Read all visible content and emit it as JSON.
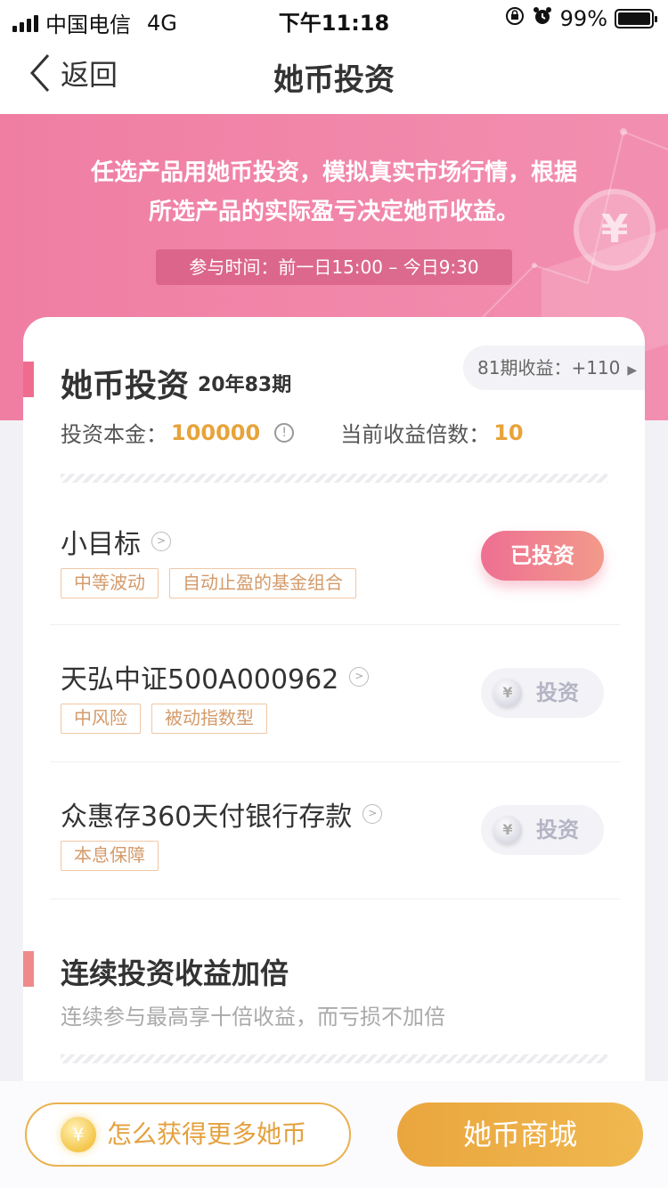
{
  "status_bar": {
    "carrier": "中国电信",
    "network": "4G",
    "time": "下午11:18",
    "battery": "99%",
    "battery_level": 0.99
  },
  "nav": {
    "back_label": "返回",
    "title": "她币投资"
  },
  "banner": {
    "line1": "任选产品用她币投资，模拟真实市场行情，根据",
    "line2": "所选产品的实际盈亏决定她币收益。",
    "time": "参与时间：前一日15:00 – 今日9:30",
    "coin_symbol": "¥"
  },
  "invest_card": {
    "title": "她币投资",
    "period": "20年83期",
    "prev_period": "81期收益：+110",
    "principal_label": "投资本金：",
    "principal_value": "100000",
    "multiplier_label": "当前收益倍数：",
    "multiplier_value": "10"
  },
  "products": [
    {
      "name": "小目标",
      "tags": [
        "中等波动",
        "自动止盈的基金组合"
      ],
      "action": "已投资",
      "invested": true
    },
    {
      "name": "天弘中证500A000962",
      "tags": [
        "中风险",
        "被动指数型"
      ],
      "action": "投资",
      "invested": false
    },
    {
      "name": "众惠存360天付银行存款",
      "tags": [
        "本息保障"
      ],
      "action": "投资",
      "invested": false
    }
  ],
  "bonus_section": {
    "title": "连续投资收益加倍",
    "subtitle": "连续参与最高享十倍收益，而亏损不加倍"
  },
  "bottom": {
    "more_coins": "怎么获得更多她币",
    "shop": "她币商城",
    "coin_symbol": "¥"
  },
  "colors": {
    "accent_pink": "#ef6c8f",
    "accent_gold": "#e8a33a",
    "banner": "#f07ea3"
  }
}
